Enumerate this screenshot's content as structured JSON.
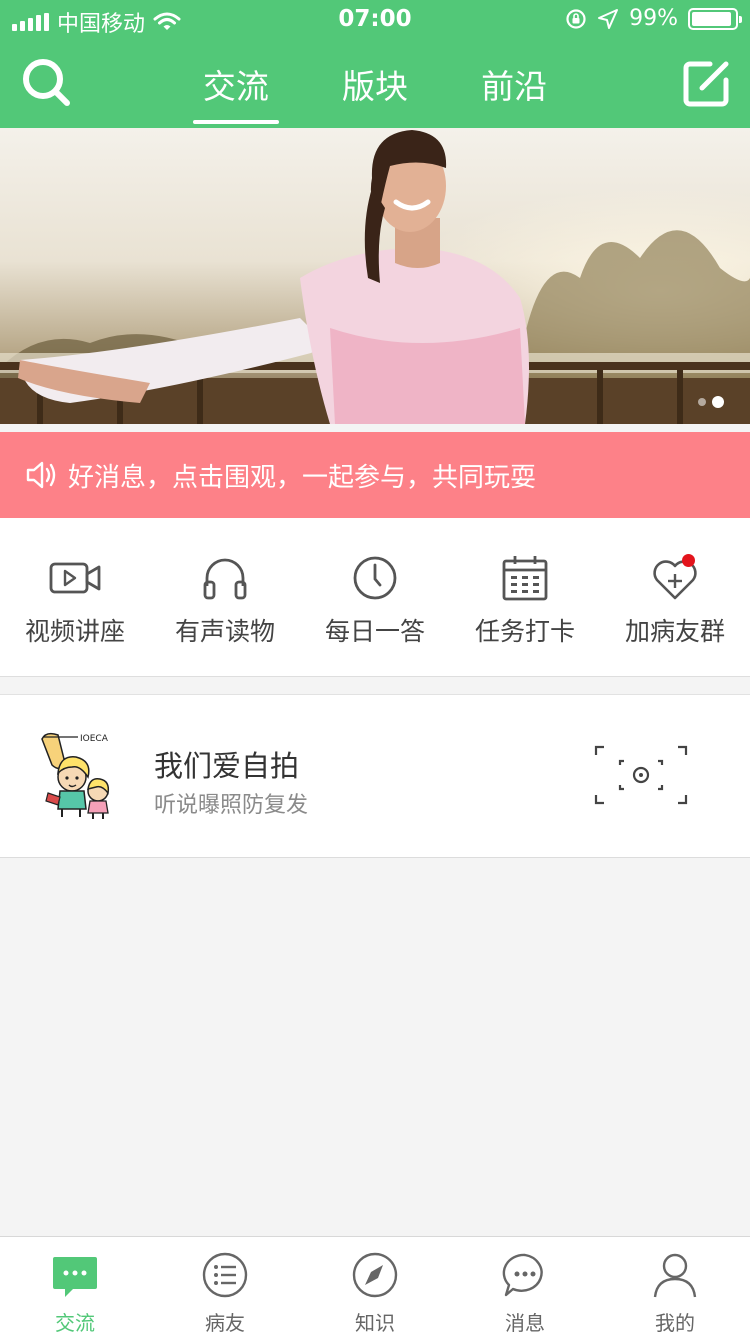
{
  "status_bar": {
    "carrier": "中国移动",
    "time": "07:00",
    "battery": "99%"
  },
  "nav": {
    "tabs": [
      {
        "label": "交流",
        "active": true
      },
      {
        "label": "版块",
        "active": false
      },
      {
        "label": "前沿",
        "active": false
      }
    ],
    "search_icon": "search-icon",
    "compose_icon": "compose-icon"
  },
  "banner": {
    "page_count": 2,
    "current_page": 2
  },
  "notice": {
    "text": "好消息，点击围观，一起参与，共同玩耍",
    "icon": "speaker-icon"
  },
  "quick_links": [
    {
      "label": "视频讲座",
      "icon": "video-icon"
    },
    {
      "label": "有声读物",
      "icon": "headphones-icon"
    },
    {
      "label": "每日一答",
      "icon": "clock-icon"
    },
    {
      "label": "任务打卡",
      "icon": "calendar-icon"
    },
    {
      "label": "加病友群",
      "icon": "heart-plus-icon",
      "badge": true
    }
  ],
  "feature_card": {
    "title": "我们爱自拍",
    "subtitle": "听说曝照防复发",
    "action_icon": "camera-scan-icon",
    "avatar_lettering": "IOECA"
  },
  "tab_bar": [
    {
      "label": "交流",
      "icon": "chat-bubble-icon",
      "active": true
    },
    {
      "label": "病友",
      "icon": "list-icon",
      "active": false
    },
    {
      "label": "知识",
      "icon": "compass-icon",
      "active": false
    },
    {
      "label": "消息",
      "icon": "message-icon",
      "active": false
    },
    {
      "label": "我的",
      "icon": "user-icon",
      "active": false
    }
  ],
  "colors": {
    "primary": "#52c878",
    "notice": "#fd8188",
    "badge": "#e3141c"
  }
}
